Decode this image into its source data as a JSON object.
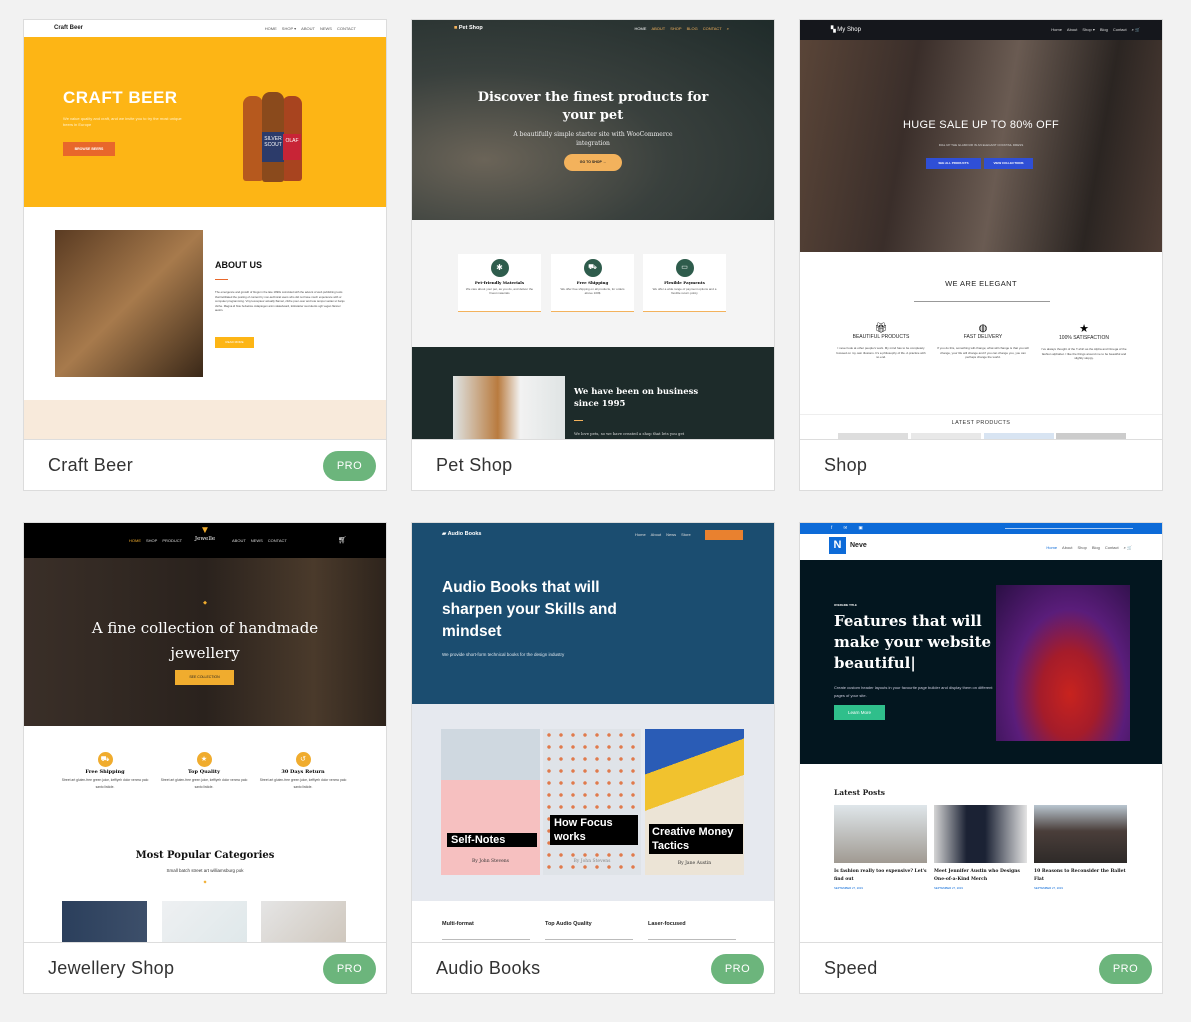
{
  "accent_pro": "#6cb57c",
  "cards": [
    {
      "name": "Craft Beer",
      "badge": "PRO",
      "logo": "Craft Beer",
      "nav": [
        "HOME",
        "SHOP ▾",
        "ABOUT",
        "NEWS",
        "CONTACT"
      ],
      "hero_title": "CRAFT BEER",
      "hero_text": "We value quality and craft, and we invite you to try the most unique beers in Europe",
      "hero_button": "BROWSE BEERS",
      "bottle_labels": [
        "SILVER SCOUT",
        "OLAF"
      ],
      "about_title": "ABOUT US",
      "about_text": "The emergence and growth of blogs in the late 1990s coincided with the advent of web publishing tools that facilitated the posting of content by non-technical users who did not have much experience with or computer programming. Vinyl excepteur actually flannel, cliche pour-over and tote tempor seitan ut banjo cliche. Magna id fixie helvetica. Adaptogen anim skateboard, kickstarter succulents ugh vegan flannel austin.",
      "about_button": "READ MORE",
      "colors": {
        "hero": "#fdb515",
        "button": "#e8672b"
      }
    },
    {
      "name": "Pet Shop",
      "logo": "Pet Shop",
      "nav": [
        "HOME",
        "ABOUT",
        "SHOP",
        "BLOG",
        "CONTACT"
      ],
      "hero_title": "Discover the finest products for your pet",
      "hero_text": "A beautifully simple starter site with WooCommerce integration",
      "hero_button": "GO TO SHOP →",
      "features": [
        {
          "icon": "paw-icon",
          "title": "Pet-friendly Materials",
          "text": "We care about your pet, as you do, and deliver the finest materials"
        },
        {
          "icon": "truck-icon",
          "title": "Free Shipping",
          "text": "We offer free shipping on all products, for orders above 100$"
        },
        {
          "icon": "credit-card-icon",
          "title": "Flexible Payments",
          "text": "We offer a wide range of payment options and a flexible return policy"
        }
      ],
      "about_title": "We have been on business since 1995",
      "about_text": "We love pets, so we have created a shop that lets you get",
      "colors": {
        "dark": "#1d2b2a",
        "accent": "#f3b25c",
        "icon": "#2e5c4c"
      }
    },
    {
      "name": "Shop",
      "logo": "My Shop",
      "nav": [
        "Home",
        "About",
        "Shop ▾",
        "Blog",
        "Contact"
      ],
      "hero_title": "HUGE SALE UP TO 80% OFF",
      "hero_text": "DIAL UP THE GLAMOUR IN AN ELEGANT COCKTAIL DRESS",
      "hero_buttons": [
        "SEE ALL PRODUCTS",
        "VIEW COLLECTIONS"
      ],
      "section_title": "WE ARE ELEGANT",
      "features": [
        {
          "icon": "gift-icon",
          "title": "BEAUTIFUL PRODUCTS",
          "text": "I never look at other people's work. My mind has to be completely focused on my own illusions. It's a philosophy of life. A practice with no end."
        },
        {
          "icon": "globe-icon",
          "title": "FAST DELIVERY",
          "text": "If you do this, something will change; what will change is that you will change, your life will change and if you can change you, you can perhaps change the world."
        },
        {
          "icon": "star-icon",
          "title": "100% SATISFACTION",
          "text": "I've always thought of the T-shirt as the Alpha and Omega of the fashion alphabet. I like the things around me to be beautiful and slightly sloppy."
        }
      ],
      "latest_title": "LATEST PRODUCTS",
      "colors": {
        "button": "#2f4fd6",
        "nav": "#15171c"
      }
    },
    {
      "name": "Jewellery Shop",
      "badge": "PRO",
      "logo": "Jewelle",
      "nav_left": [
        "HOME",
        "SHOP",
        "PRODUCT"
      ],
      "nav_right": [
        "ABOUT",
        "NEWS",
        "CONTACT"
      ],
      "hero_title": "A fine collection of handmade jewellery",
      "hero_button": "SEE COLLECTION",
      "features": [
        {
          "icon": "truck-icon",
          "title": "Free Shipping",
          "text": "Street art gluten-free green juice, keffiyeh dolor venmo palo santo listicle."
        },
        {
          "icon": "star-icon",
          "title": "Top Quality",
          "text": "Street art gluten-free green juice, keffiyeh dolor venmo palo santo listicle."
        },
        {
          "icon": "return-icon",
          "title": "30 Days Return",
          "text": "Street art gluten-free green juice, keffiyeh dolor venmo palo santo listicle."
        }
      ],
      "section_title": "Most Popular Categories",
      "section_text": "Small batch street art williamsburg pok",
      "colors": {
        "accent": "#f0ac2e"
      }
    },
    {
      "name": "Audio Books",
      "badge": "PRO",
      "logo": "Audio Books",
      "nav": [
        "Home",
        "About",
        "News",
        "Store"
      ],
      "hero_title": "Audio Books that will sharpen your Skills and mindset",
      "hero_text": "We provide short-form technical books for the design industry",
      "books": [
        {
          "title": "Self-Notes",
          "author": "By John Stevens"
        },
        {
          "title": "How Focus works",
          "author": "By John Stevens"
        },
        {
          "title": "Creative Money Tactics",
          "author": "By Jane Austin"
        }
      ],
      "features": [
        "Multi-format",
        "Top Audio Quality",
        "Laser-focused"
      ],
      "colors": {
        "hero": "#1b4d70",
        "button": "#e9812f"
      }
    },
    {
      "name": "Speed",
      "badge": "PRO",
      "logo": "Neve",
      "nav": [
        "Home",
        "About",
        "Shop",
        "Blog",
        "Contact"
      ],
      "overline": "OVERLINE TITLE",
      "hero_title": "Features that will make your website beautiful|",
      "hero_text": "Create custom header layouts in your favourite page builder and display them on different pages of your site.",
      "hero_button": "Learn More",
      "latest_title": "Latest Posts",
      "posts": [
        {
          "title": "Is fashion really too expensive? Let's find out",
          "date": "SEPTEMBER 27, 2019"
        },
        {
          "title": "Meet Jennifer Austin who Designs One-of-a-Kind Merch",
          "date": "SEPTEMBER 27, 2019"
        },
        {
          "title": "10 Reasons to Reconsider the Ballet Flat",
          "date": "SEPTEMBER 27, 2019"
        }
      ],
      "colors": {
        "topbar": "#0d6bd8",
        "hero": "#03161f",
        "button": "#2fbf8b"
      }
    }
  ]
}
